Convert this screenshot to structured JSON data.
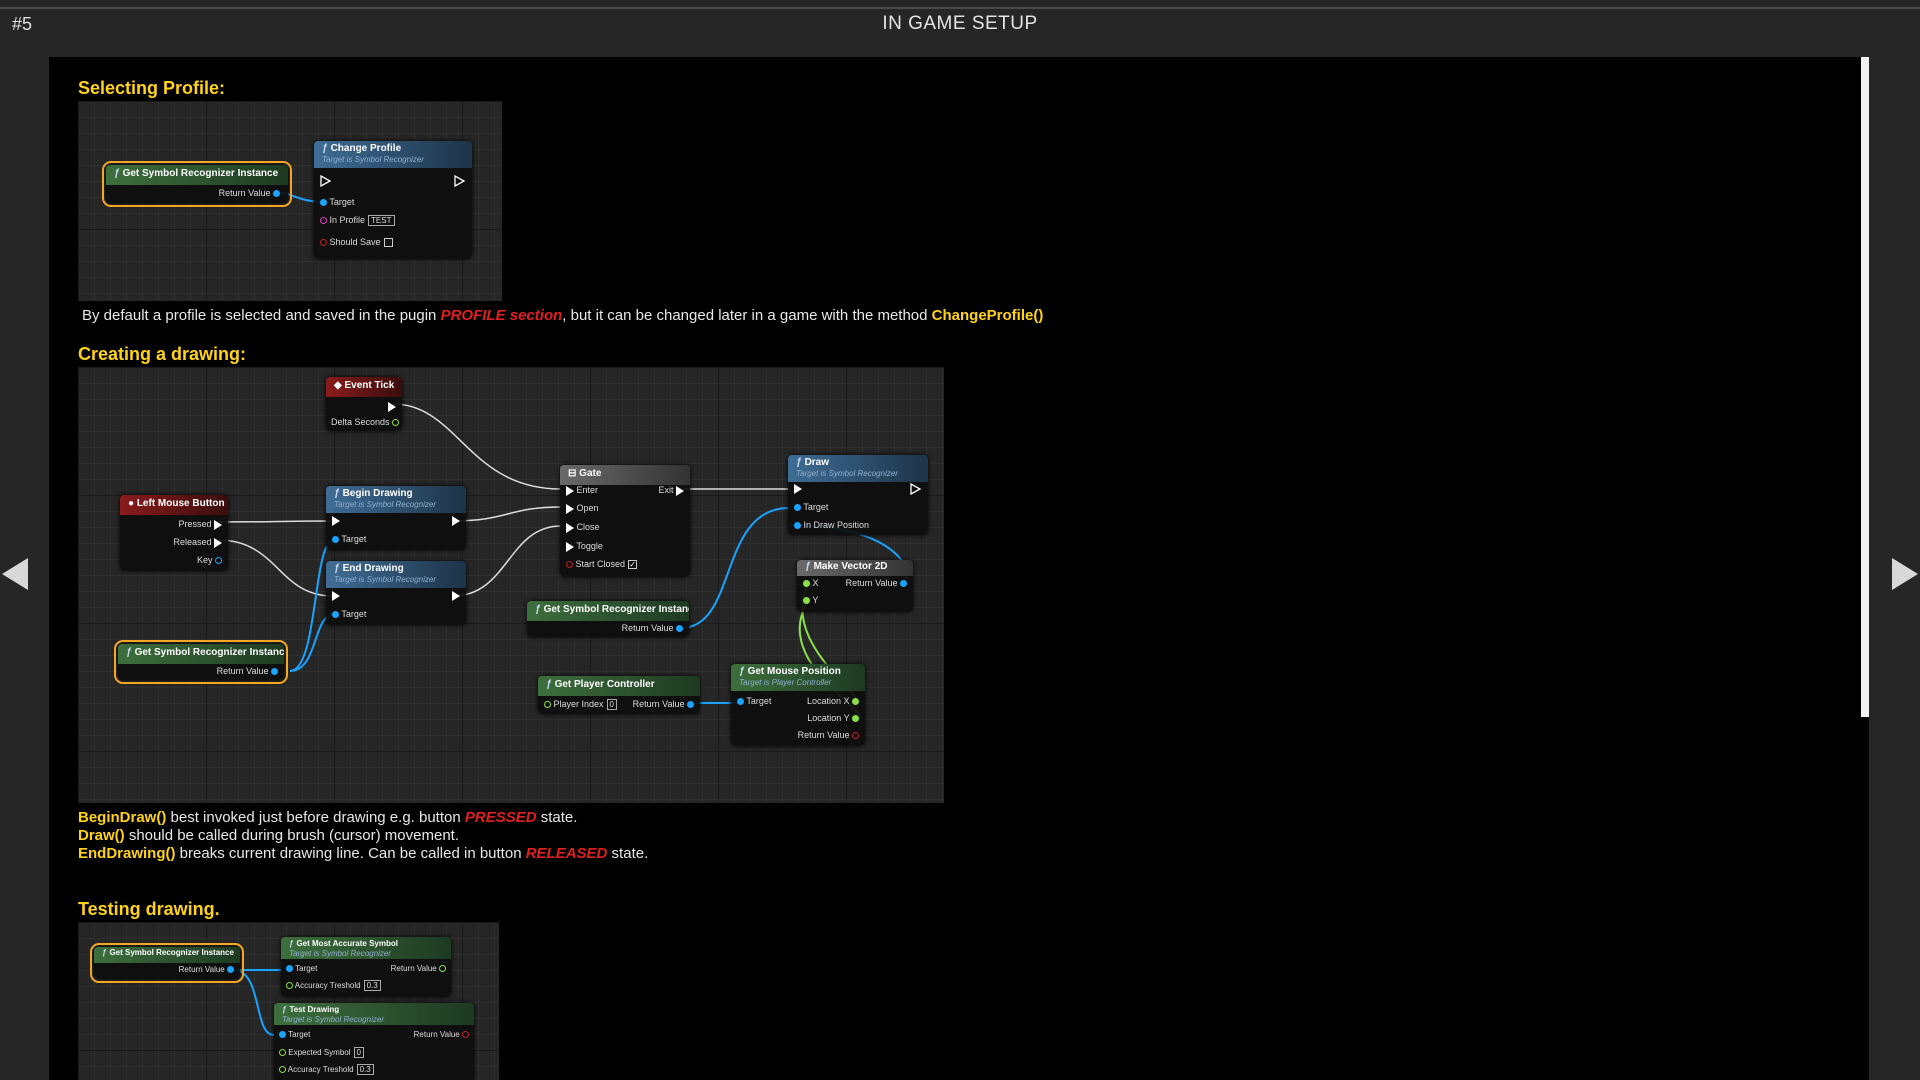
{
  "header": {
    "page_number": "#5",
    "title": "IN GAME SETUP"
  },
  "section1": {
    "heading": "Selecting Profile:",
    "text_before": "By default a profile is selected and saved in the pugin ",
    "text_red": "PROFILE section",
    "text_middle": ", but it can be changed later in a game with the method ",
    "text_yellow": "ChangeProfile()"
  },
  "section2": {
    "heading": "Creating a drawing:",
    "line1": {
      "kw": "BeginDraw()",
      "text": " best invoked just before drawing e.g. button ",
      "red": "PRESSED",
      "end": " state."
    },
    "line2": {
      "kw": "Draw()",
      "text": " should be called during brush (cursor) movement."
    },
    "line3": {
      "kw": "EndDrawing()",
      "text": " breaks current drawing line. Can be called in button ",
      "red": "RELEASED",
      "end": " state."
    }
  },
  "section3": {
    "heading": "Testing drawing."
  },
  "bp1": {
    "get_instance": {
      "title": "Get Symbol Recognizer Instance",
      "return": "Return Value"
    },
    "change_profile": {
      "title": "Change Profile",
      "subtitle": "Target is Symbol Recognizer",
      "target": "Target",
      "in_profile": "In Profile",
      "profile_value": "TEST",
      "should_save": "Should Save"
    }
  },
  "bp2": {
    "event_tick": {
      "title": "Event Tick",
      "delta": "Delta Seconds"
    },
    "left_mouse": {
      "title": "Left Mouse Button",
      "pressed": "Pressed",
      "released": "Released",
      "key": "Key"
    },
    "begin_drawing": {
      "title": "Begin Drawing",
      "subtitle": "Target is Symbol Recognizer",
      "target": "Target"
    },
    "end_drawing": {
      "title": "End Drawing",
      "subtitle": "Target is Symbol Recognizer",
      "target": "Target"
    },
    "get_instance_a": {
      "title": "Get Symbol Recognizer Instance",
      "return": "Return Value"
    },
    "get_instance_b": {
      "title": "Get Symbol Recognizer Instance",
      "return": "Return Value"
    },
    "gate": {
      "title": "Gate",
      "enter": "Enter",
      "exit": "Exit",
      "open": "Open",
      "close": "Close",
      "toggle": "Toggle",
      "start_closed": "Start Closed"
    },
    "draw": {
      "title": "Draw",
      "subtitle": "Target is Symbol Recognizer",
      "target": "Target",
      "in_draw_position": "In Draw Position"
    },
    "make_vector": {
      "title": "Make Vector 2D",
      "x": "X",
      "y": "Y",
      "return": "Return Value"
    },
    "get_player_controller": {
      "title": "Get Player Controller",
      "player_index": "Player Index",
      "index_value": "0",
      "return": "Return Value"
    },
    "get_mouse_position": {
      "title": "Get Mouse Position",
      "subtitle": "Target is Player Controller",
      "target": "Target",
      "location_x": "Location X",
      "location_y": "Location Y",
      "return": "Return Value"
    }
  },
  "bp3": {
    "get_instance": {
      "title": "Get Symbol Recognizer Instance",
      "return": "Return Value"
    },
    "get_most_accurate": {
      "title": "Get Most Accurate Symbol",
      "subtitle": "Target is Symbol Recognizer",
      "target": "Target",
      "threshold": "Accuracy Treshold",
      "threshold_value": "0.3",
      "return": "Return Value"
    },
    "test_drawing": {
      "title": "Test Drawing",
      "subtitle": "Target is Symbol Recognizer",
      "target": "Target",
      "expected": "Expected Symbol",
      "expected_value": "0",
      "threshold": "Accuracy Treshold",
      "threshold_value": "0.3",
      "return": "Return Value"
    }
  },
  "colors": {
    "heading": "#ffd21a",
    "keyword_red": "#e02020",
    "selection": "#f5a623",
    "object_pin": "#1aa3ff",
    "vector_pin": "#8be04a"
  }
}
